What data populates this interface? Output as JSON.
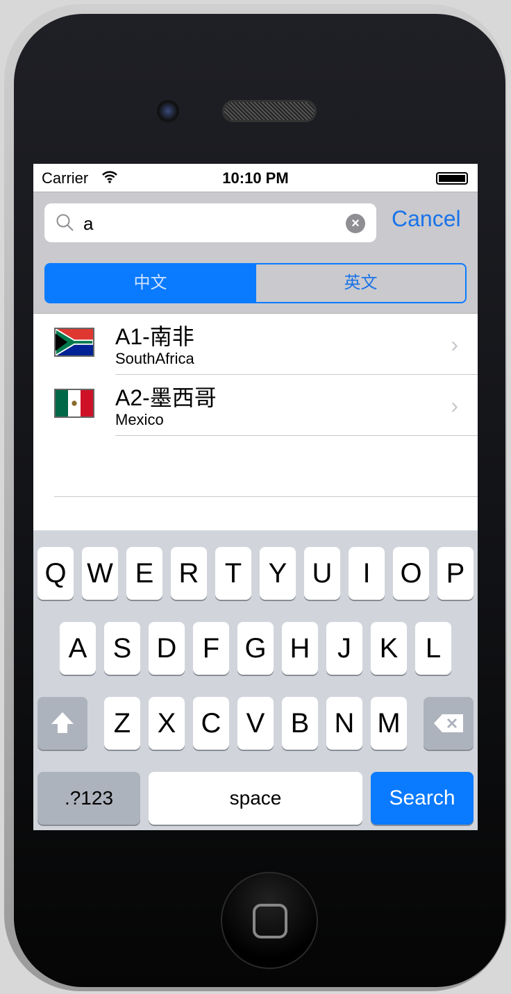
{
  "status": {
    "carrier": "Carrier",
    "time": "10:10 PM",
    "icons": [
      "wifi-icon",
      "battery-icon"
    ]
  },
  "search": {
    "value": "a",
    "cancel_label": "Cancel",
    "icons": [
      "search-icon",
      "clear-icon"
    ]
  },
  "segments": [
    {
      "label": "中文",
      "selected": true
    },
    {
      "label": "英文",
      "selected": false
    }
  ],
  "results": [
    {
      "title": "A1-南非",
      "subtitle": "SouthAfrica",
      "flag": "south-africa"
    },
    {
      "title": "A2-墨西哥",
      "subtitle": "Mexico",
      "flag": "mexico"
    }
  ],
  "keyboard": {
    "row1": [
      "Q",
      "W",
      "E",
      "R",
      "T",
      "Y",
      "U",
      "I",
      "O",
      "P"
    ],
    "row2": [
      "A",
      "S",
      "D",
      "F",
      "G",
      "H",
      "J",
      "K",
      "L"
    ],
    "row3": [
      "Z",
      "X",
      "C",
      "V",
      "B",
      "N",
      "M"
    ],
    "numbers_label": ".?123",
    "space_label": "space",
    "search_label": "Search"
  },
  "colors": {
    "accent": "#0a7aff",
    "searchbar_bg": "#c9c9ce",
    "keyboard_bg": "#d1d5db"
  }
}
